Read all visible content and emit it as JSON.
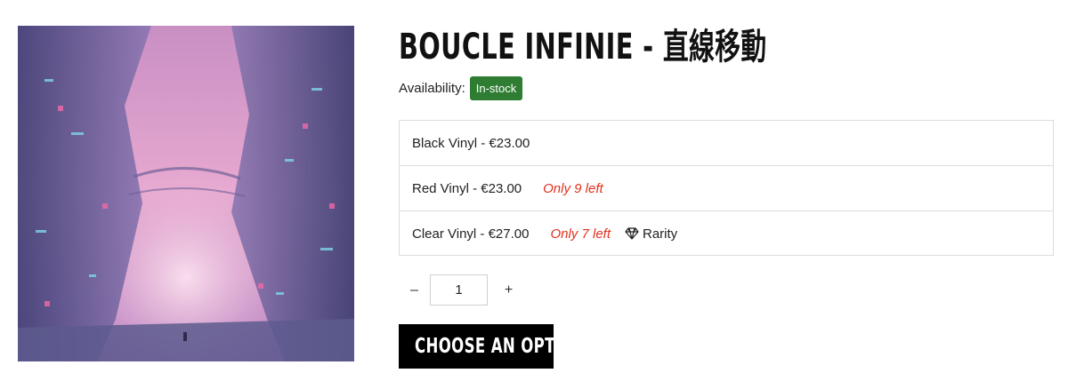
{
  "product": {
    "title": "BOUCLE INFINIE - 直線移動",
    "availability_label": "Availability:",
    "availability_status": "In-stock",
    "status_color": "#2e7d32",
    "cover_icon": "album-cover-art"
  },
  "variants": [
    {
      "label": "Black Vinyl - €23.00",
      "stock": "",
      "tag": ""
    },
    {
      "label": "Red Vinyl - €23.00",
      "stock": "Only 9 left",
      "tag": ""
    },
    {
      "label": "Clear Vinyl - €27.00",
      "stock": "Only 7 left",
      "tag": "Rarity",
      "tag_icon": "diamond-icon"
    }
  ],
  "quantity": {
    "minus": "–",
    "value": "1",
    "plus": "+"
  },
  "cta": {
    "label": "CHOOSE AN OPTION"
  }
}
